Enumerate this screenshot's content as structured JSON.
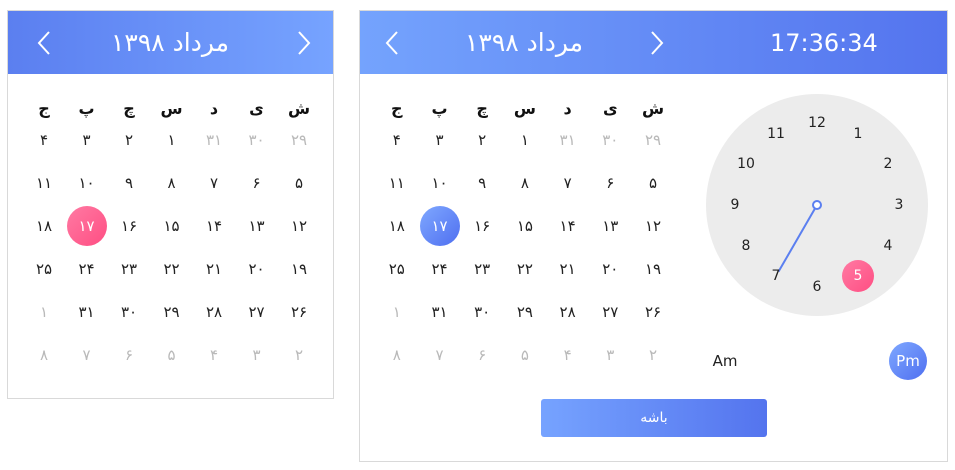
{
  "calendar_simple": {
    "title": "مرداد ۱۳۹۸",
    "prev_icon": "chevron-left-icon",
    "next_icon": "chevron-right-icon",
    "weekdays": [
      "ش",
      "ی",
      "د",
      "س",
      "چ",
      "پ",
      "ج"
    ],
    "weeks": [
      [
        {
          "t": "۲۹",
          "muted": true
        },
        {
          "t": "۳۰",
          "muted": true
        },
        {
          "t": "۳۱",
          "muted": true
        },
        {
          "t": "۱"
        },
        {
          "t": "۲"
        },
        {
          "t": "۳"
        },
        {
          "t": "۴"
        }
      ],
      [
        {
          "t": "۵"
        },
        {
          "t": "۶"
        },
        {
          "t": "۷"
        },
        {
          "t": "۸"
        },
        {
          "t": "۹"
        },
        {
          "t": "۱۰"
        },
        {
          "t": "۱۱"
        }
      ],
      [
        {
          "t": "۱۲"
        },
        {
          "t": "۱۳"
        },
        {
          "t": "۱۴"
        },
        {
          "t": "۱۵"
        },
        {
          "t": "۱۶"
        },
        {
          "t": "۱۷",
          "selected": true
        },
        {
          "t": "۱۸"
        }
      ],
      [
        {
          "t": "۱۹"
        },
        {
          "t": "۲۰"
        },
        {
          "t": "۲۱"
        },
        {
          "t": "۲۲"
        },
        {
          "t": "۲۳"
        },
        {
          "t": "۲۴"
        },
        {
          "t": "۲۵"
        }
      ],
      [
        {
          "t": "۲۶"
        },
        {
          "t": "۲۷"
        },
        {
          "t": "۲۸"
        },
        {
          "t": "۲۹"
        },
        {
          "t": "۳۰"
        },
        {
          "t": "۳۱"
        },
        {
          "t": "۱",
          "muted": true
        }
      ],
      [
        {
          "t": "۲",
          "muted": true
        },
        {
          "t": "۳",
          "muted": true
        },
        {
          "t": "۴",
          "muted": true
        },
        {
          "t": "۵",
          "muted": true
        },
        {
          "t": "۶",
          "muted": true
        },
        {
          "t": "۷",
          "muted": true
        },
        {
          "t": "۸",
          "muted": true
        }
      ]
    ],
    "accent": "#ff4e83"
  },
  "calendar_datetime": {
    "title": "مرداد ۱۳۹۸",
    "time": "17:36:34",
    "prev_icon": "chevron-left-icon",
    "next_icon": "chevron-right-icon",
    "weekdays": [
      "ش",
      "ی",
      "د",
      "س",
      "چ",
      "پ",
      "ج"
    ],
    "weeks": [
      [
        {
          "t": "۲۹",
          "muted": true
        },
        {
          "t": "۳۰",
          "muted": true
        },
        {
          "t": "۳۱",
          "muted": true
        },
        {
          "t": "۱"
        },
        {
          "t": "۲"
        },
        {
          "t": "۳"
        },
        {
          "t": "۴"
        }
      ],
      [
        {
          "t": "۵"
        },
        {
          "t": "۶"
        },
        {
          "t": "۷"
        },
        {
          "t": "۸"
        },
        {
          "t": "۹"
        },
        {
          "t": "۱۰"
        },
        {
          "t": "۱۱"
        }
      ],
      [
        {
          "t": "۱۲"
        },
        {
          "t": "۱۳"
        },
        {
          "t": "۱۴"
        },
        {
          "t": "۱۵"
        },
        {
          "t": "۱۶"
        },
        {
          "t": "۱۷",
          "selected": true
        },
        {
          "t": "۱۸"
        }
      ],
      [
        {
          "t": "۱۹"
        },
        {
          "t": "۲۰"
        },
        {
          "t": "۲۱"
        },
        {
          "t": "۲۲"
        },
        {
          "t": "۲۳"
        },
        {
          "t": "۲۴"
        },
        {
          "t": "۲۵"
        }
      ],
      [
        {
          "t": "۲۶"
        },
        {
          "t": "۲۷"
        },
        {
          "t": "۲۸"
        },
        {
          "t": "۲۹"
        },
        {
          "t": "۳۰"
        },
        {
          "t": "۳۱"
        },
        {
          "t": "۱",
          "muted": true
        }
      ],
      [
        {
          "t": "۲",
          "muted": true
        },
        {
          "t": "۳",
          "muted": true
        },
        {
          "t": "۴",
          "muted": true
        },
        {
          "t": "۵",
          "muted": true
        },
        {
          "t": "۶",
          "muted": true
        },
        {
          "t": "۷",
          "muted": true
        },
        {
          "t": "۸",
          "muted": true
        }
      ]
    ],
    "accent": "#4f6ff0",
    "clock": {
      "hours": [
        "12",
        "1",
        "2",
        "3",
        "4",
        "5",
        "6",
        "7",
        "8",
        "9",
        "10",
        "11"
      ],
      "selected_hour": "5",
      "hand_points_to": "7"
    },
    "am_label": "Am",
    "pm_label": "Pm",
    "active_period": "Pm",
    "ok_label": "باشه"
  }
}
